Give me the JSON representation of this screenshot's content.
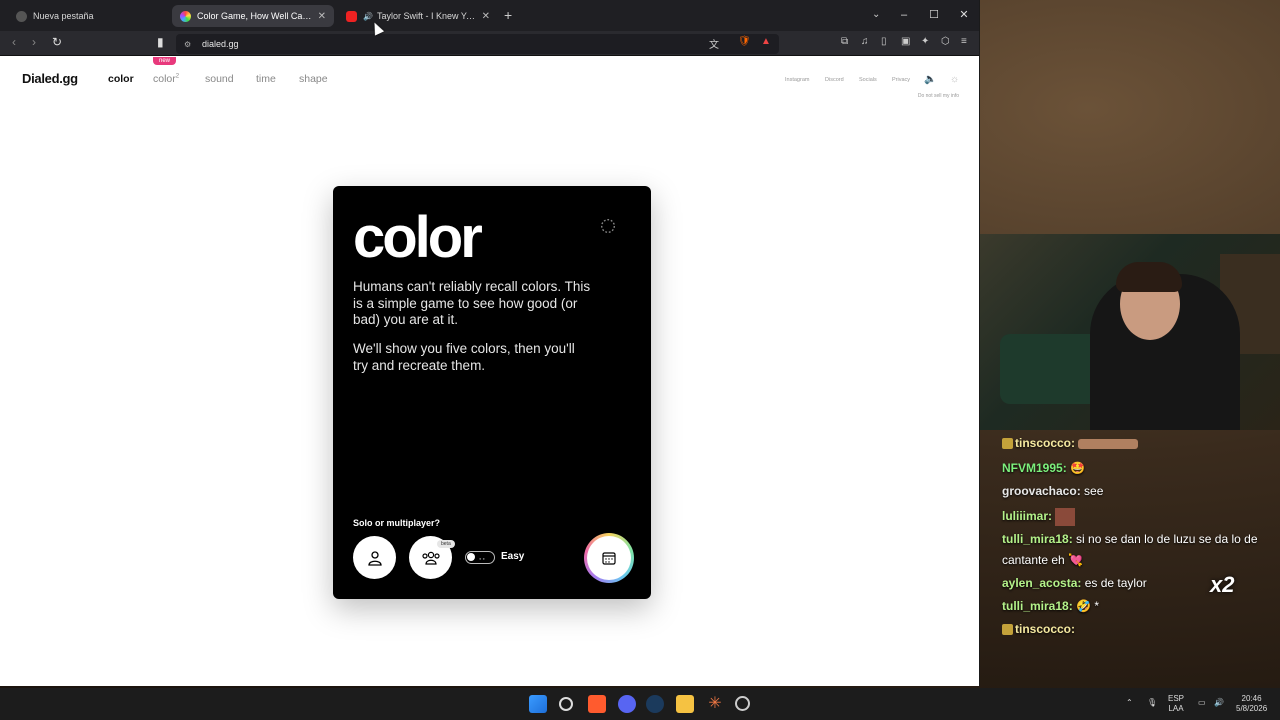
{
  "browser": {
    "tabs": [
      {
        "title": "Nueva pestaña",
        "active": false
      },
      {
        "title": "Color Game, How Well Can You I",
        "active": true
      },
      {
        "title": "Taylor Swift - I Knew You Wer",
        "active": false
      }
    ],
    "url": "dialed.gg"
  },
  "site": {
    "logo": "Dialed.gg",
    "nav": {
      "color": "color",
      "color2": "color",
      "color2_sup": "2",
      "sound": "sound",
      "time": "time",
      "shape": "shape",
      "new_badge": "new"
    },
    "right_links": {
      "instagram": "Instagram",
      "discord": "Discord",
      "socials": "Socials",
      "privacy": "Privacy"
    },
    "do_not_sell": "Do not sell my info"
  },
  "card": {
    "title": "color",
    "description": "Humans can't reliably recall colors. This is a simple game to see how good (or bad) you are at it.",
    "description2": "We'll show you five colors, then you'll try and recreate them.",
    "solo_label": "Solo or multiplayer?",
    "beta_label": "beta",
    "difficulty_label": "Easy"
  },
  "chat": {
    "messages": [
      {
        "user": "tinscocco:",
        "text": "",
        "color": "#f5e9a0",
        "badge": true
      },
      {
        "user": "NFVM1995:",
        "text": "🤩",
        "color": "#7cf07c",
        "badge": false
      },
      {
        "user": "groovachaco:",
        "text": "see",
        "color": "#e8e8e8",
        "badge": false
      },
      {
        "user": "luliiimar:",
        "text": "",
        "color": "#b4f28a",
        "badge": false
      },
      {
        "user": "tulli_mira18:",
        "text": "si no se dan lo de luzu se da lo de",
        "color": "#b4f28a",
        "badge": false
      },
      {
        "user": "",
        "text": "cantante eh 💘",
        "color": "#e8e8e8",
        "badge": false
      },
      {
        "user": "aylen_acosta:",
        "text": "es de taylor",
        "color": "#b4f28a",
        "badge": false
      },
      {
        "user": "tulli_mira18:",
        "text": "🤣 *",
        "color": "#b4f28a",
        "badge": false
      },
      {
        "user": "tinscocco:",
        "text": "",
        "color": "#f5e9a0",
        "badge": true
      }
    ],
    "multiplier": "x2"
  },
  "taskbar": {
    "lang1": "ESP",
    "lang2": "LAA",
    "time": "20:46",
    "date": "5/8/2026"
  },
  "colors": {
    "accent_new": "#e8397c",
    "card_bg": "#000000"
  }
}
